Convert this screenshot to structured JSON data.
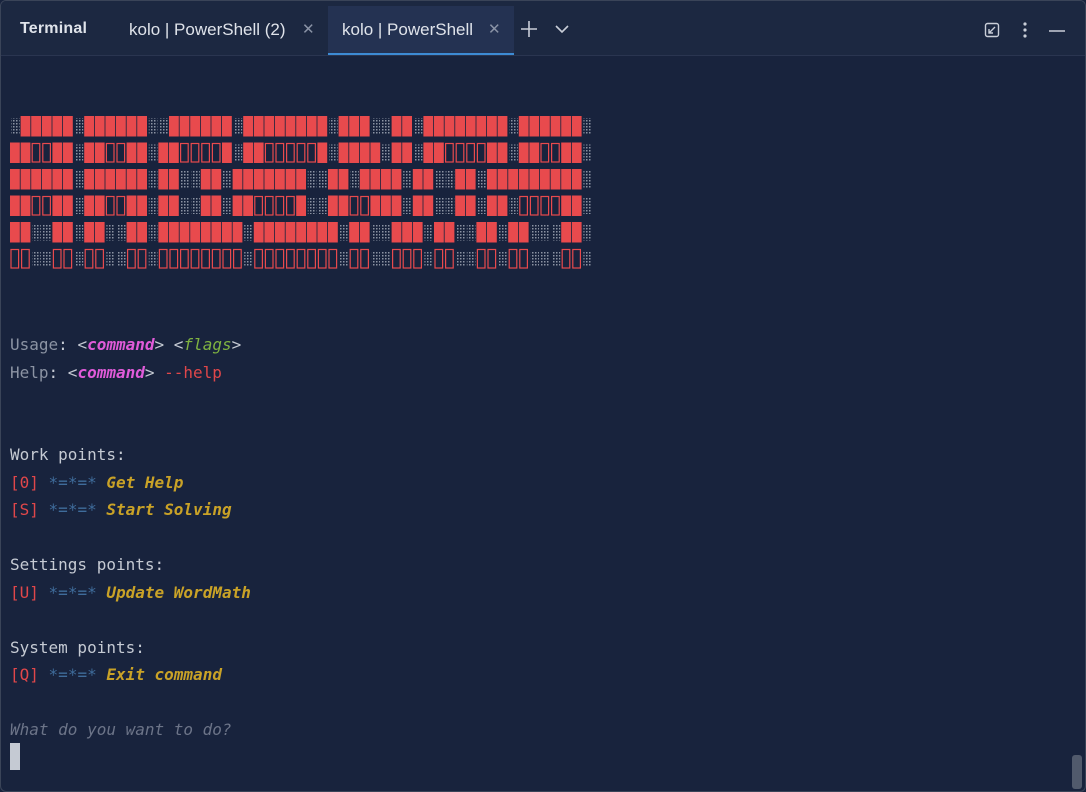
{
  "window": {
    "title": "Terminal",
    "tabs": [
      {
        "label": "kolo | PowerShell (2)"
      },
      {
        "label": "kolo | PowerShell"
      }
    ]
  },
  "terminal": {
    "usage": {
      "label": "Usage",
      "command": "command",
      "flags": "flags"
    },
    "help": {
      "label": "Help",
      "command": "command",
      "flag": "--help"
    },
    "sections": [
      {
        "title": "Work points:",
        "items": [
          {
            "key": "[0]",
            "sep": "*=*=*",
            "text": "Get Help"
          },
          {
            "key": "[S]",
            "sep": "*=*=*",
            "text": "Start Solving"
          }
        ]
      },
      {
        "title": "Settings points:",
        "items": [
          {
            "key": "[U]",
            "sep": "*=*=*",
            "text": "Update WordMath"
          }
        ]
      },
      {
        "title": "System points:",
        "items": [
          {
            "key": "[Q]",
            "sep": "*=*=*",
            "text": "Exit command"
          }
        ]
      }
    ],
    "prompt": "What do you want to do?"
  },
  "colors": {
    "background": "#18233d",
    "banner": "#e84a4d",
    "tab_accent": "#3d8bd4"
  },
  "icons": [
    "close-icon",
    "plus-icon",
    "chevron-down-icon",
    "pin-icon",
    "more-vertical-icon",
    "minimize-icon"
  ]
}
